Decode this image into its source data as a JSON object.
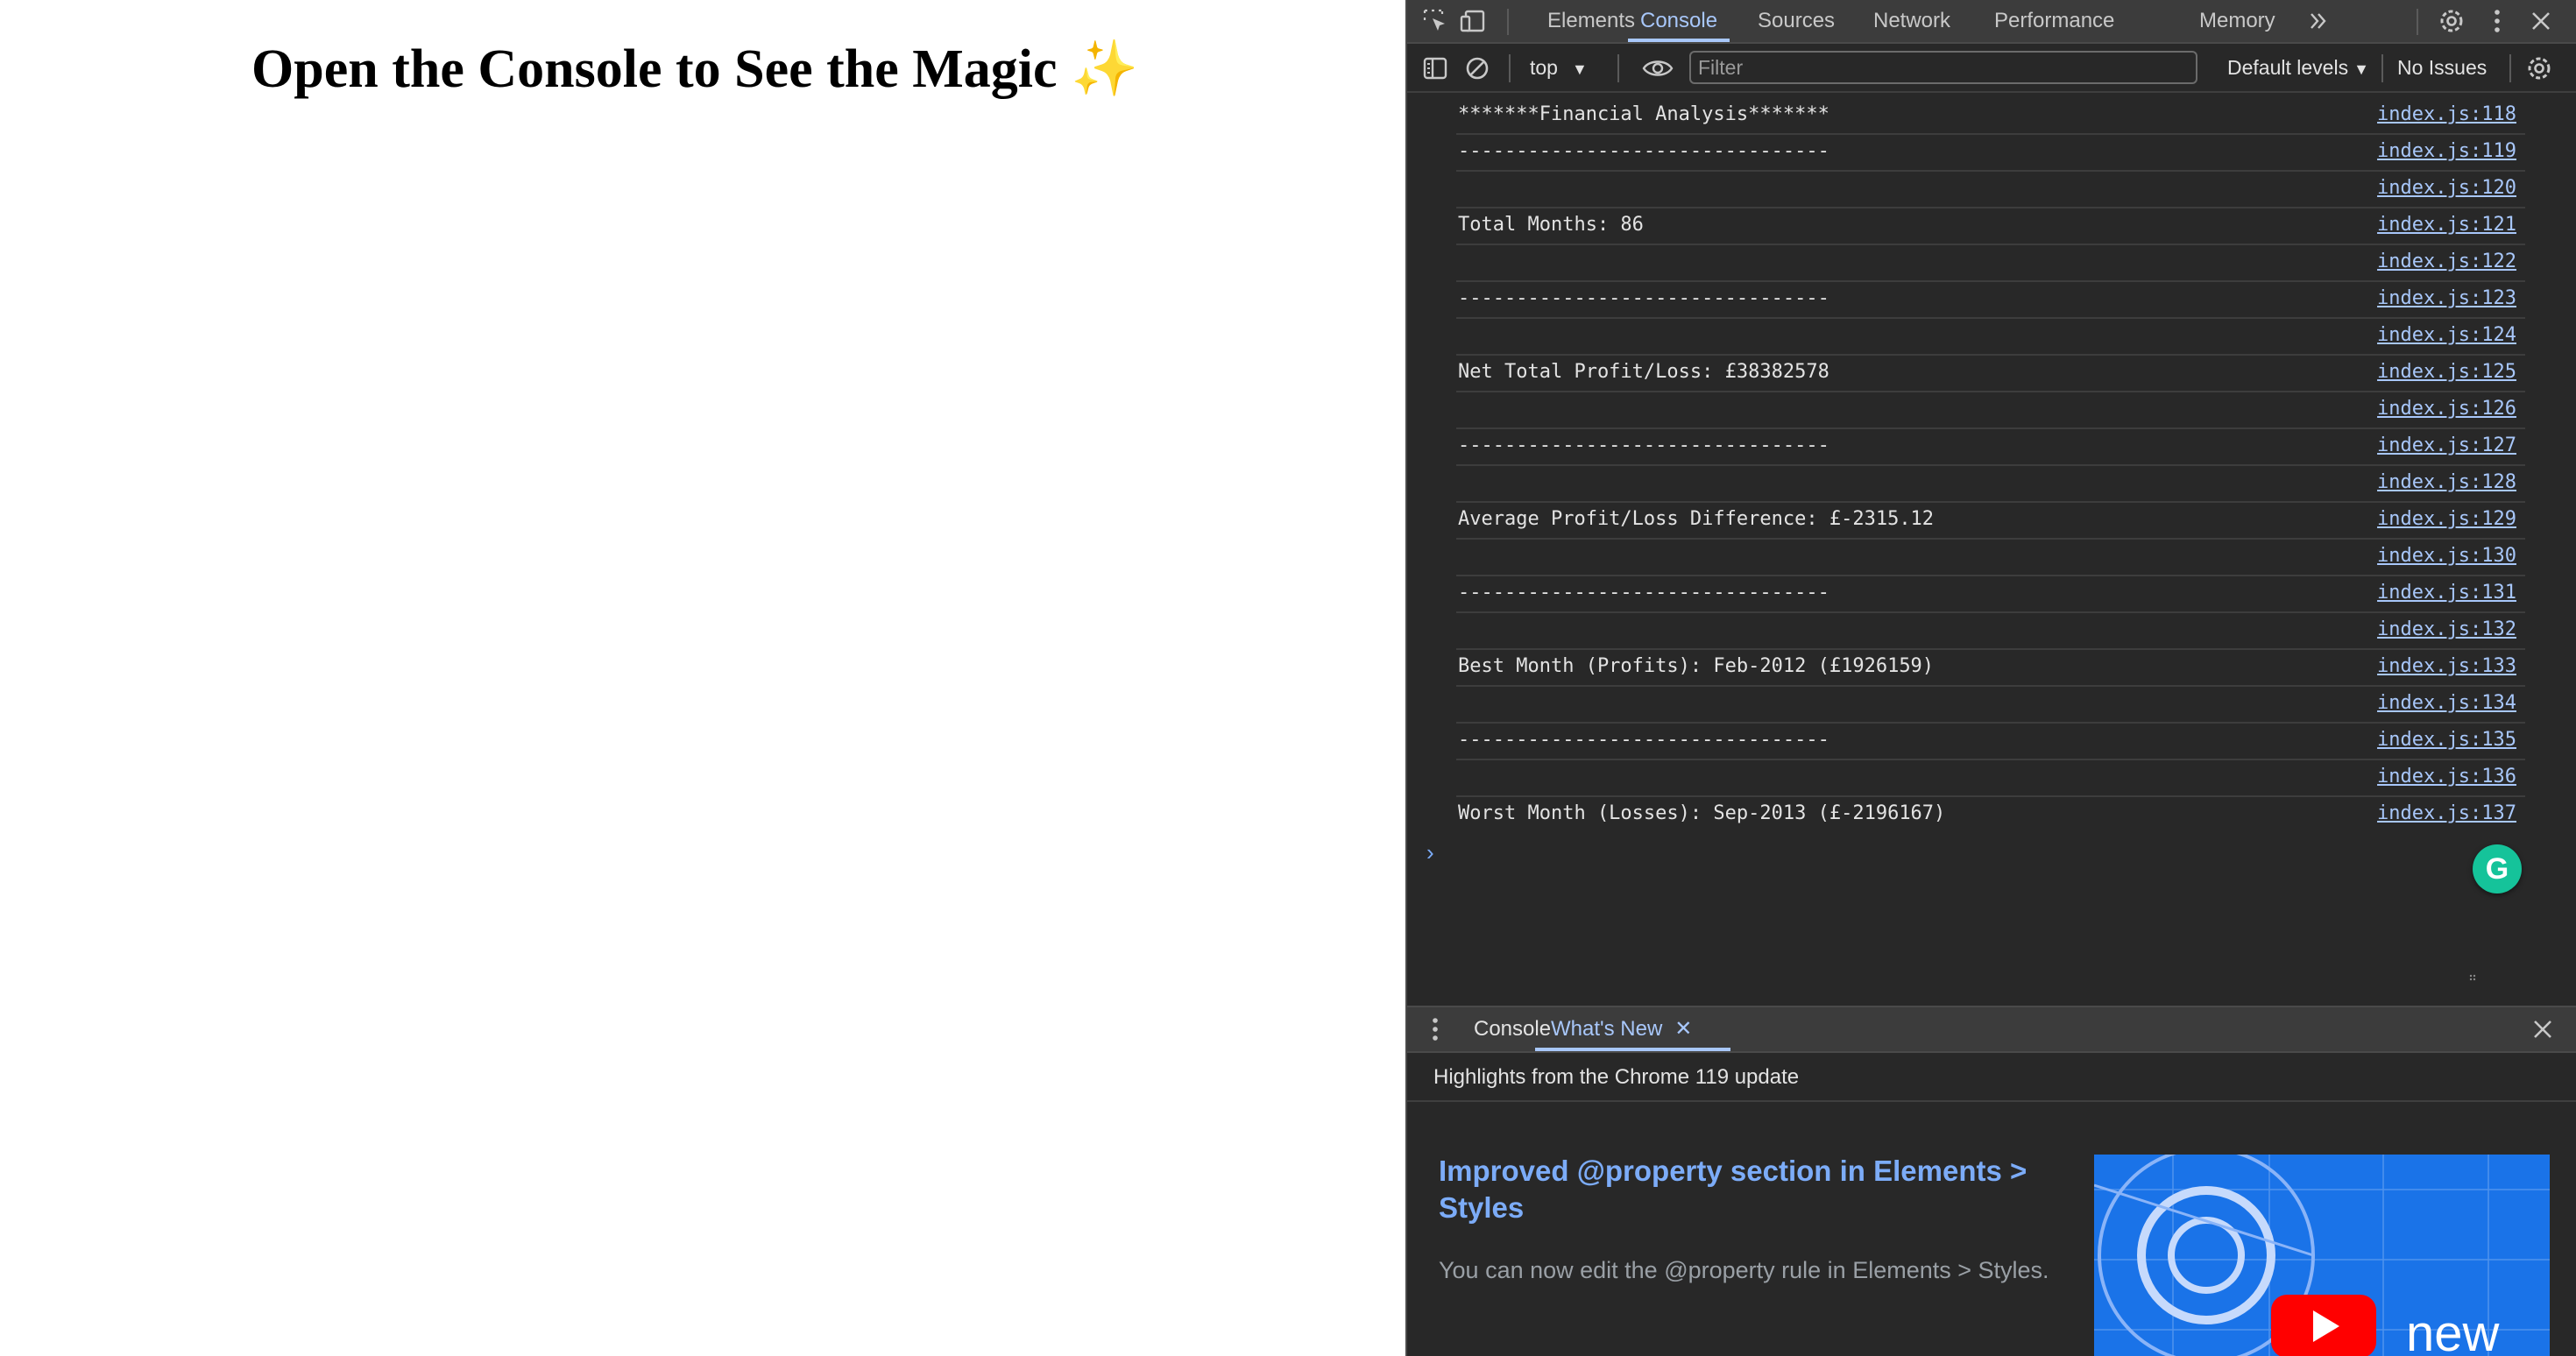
{
  "page": {
    "title": "Open the Console to See the Magic",
    "title_emoji": "✨"
  },
  "devtools": {
    "tabs": [
      "Elements",
      "Console",
      "Sources",
      "Network",
      "Performance",
      "Memory"
    ],
    "active_tab": "Console",
    "toolbar": {
      "context": "top",
      "filter_placeholder": "Filter",
      "levels": "Default levels",
      "issues": "No Issues"
    },
    "console_rows": [
      {
        "text": "*******Financial Analysis*******",
        "source": "index.js:118"
      },
      {
        "text": "--------------------------------",
        "source": "index.js:119"
      },
      {
        "text": "",
        "source": "index.js:120"
      },
      {
        "text": "Total Months: 86",
        "source": "index.js:121"
      },
      {
        "text": "",
        "source": "index.js:122"
      },
      {
        "text": "--------------------------------",
        "source": "index.js:123"
      },
      {
        "text": "",
        "source": "index.js:124"
      },
      {
        "text": "Net Total Profit/Loss: £38382578",
        "source": "index.js:125"
      },
      {
        "text": "",
        "source": "index.js:126"
      },
      {
        "text": "--------------------------------",
        "source": "index.js:127"
      },
      {
        "text": "",
        "source": "index.js:128"
      },
      {
        "text": "Average Profit/Loss Difference: £-2315.12",
        "source": "index.js:129"
      },
      {
        "text": "",
        "source": "index.js:130"
      },
      {
        "text": "--------------------------------",
        "source": "index.js:131"
      },
      {
        "text": "",
        "source": "index.js:132"
      },
      {
        "text": "Best Month (Profits): Feb-2012 (£1926159)",
        "source": "index.js:133"
      },
      {
        "text": "",
        "source": "index.js:134"
      },
      {
        "text": "--------------------------------",
        "source": "index.js:135"
      },
      {
        "text": "",
        "source": "index.js:136"
      },
      {
        "text": "Worst Month (Losses): Sep-2013 (£-2196167)",
        "source": "index.js:137"
      }
    ],
    "prompt_symbol": "›",
    "grammarly_letter": "G",
    "drawer": {
      "tabs": [
        "Console",
        "What's New"
      ],
      "active_tab": "What's New",
      "highlights": "Highlights from the Chrome 119 update",
      "feature_title": "Improved @property section in Elements > Styles",
      "feature_body": "You can now edit the @property rule in Elements > Styles.",
      "thumbnail_word": "new"
    }
  },
  "colors": {
    "accent": "#a8c7fa",
    "link": "#7cacf8",
    "panel_bg": "#282828",
    "toolbar_bg": "#3c3c3c",
    "grammarly": "#15c39a",
    "youtube_red": "#ff0000"
  }
}
